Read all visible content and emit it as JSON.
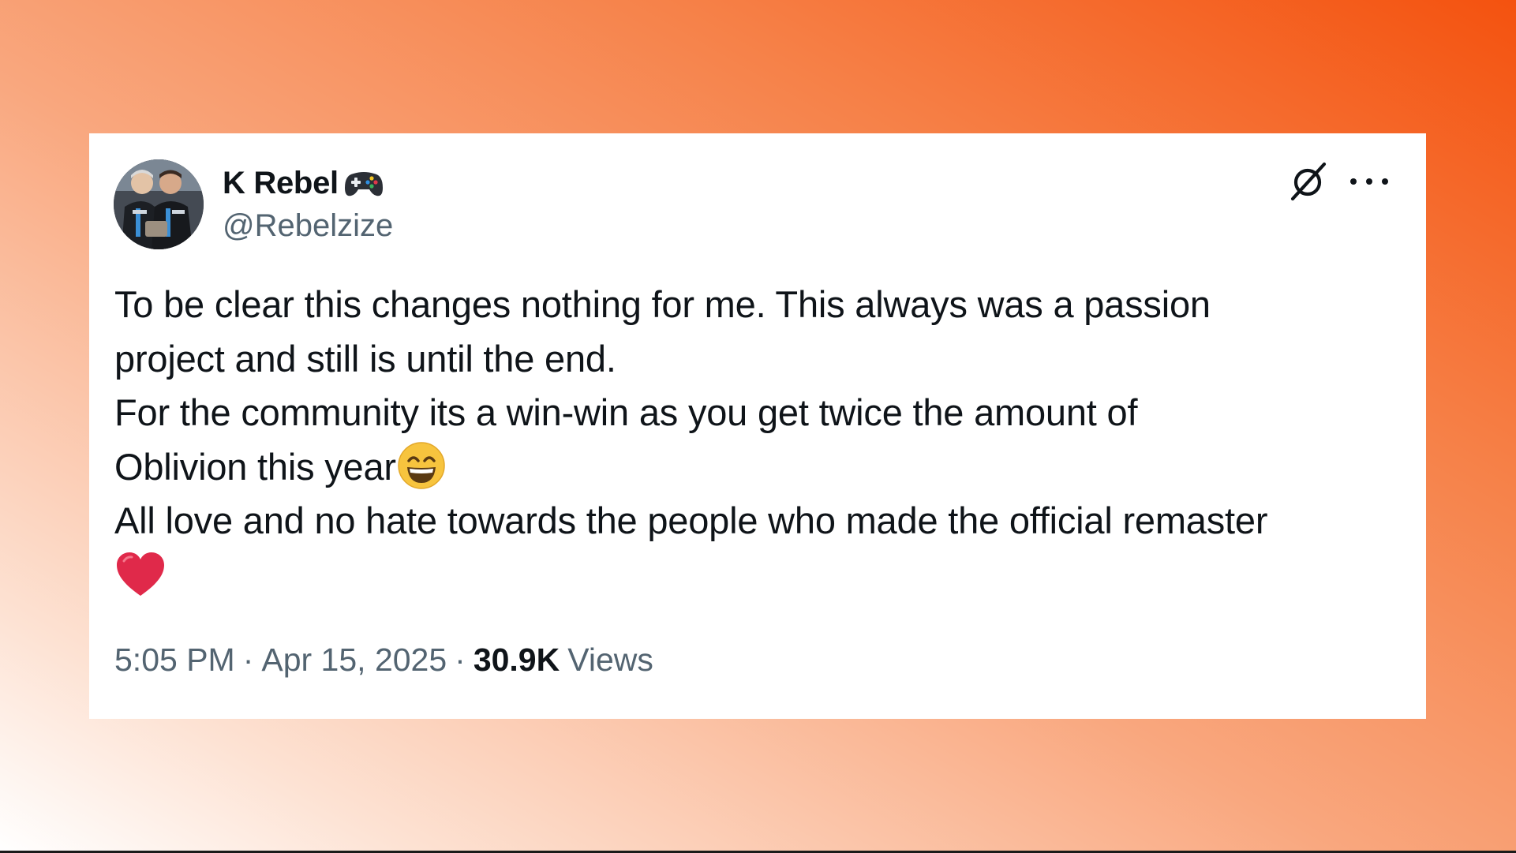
{
  "post": {
    "author": {
      "display_name": "K Rebel",
      "name_emoji": "gamepad-icon",
      "handle": "@Rebelzize"
    },
    "text_lines": [
      "To be clear this changes nothing for me. This always was a passion",
      "project and still is until the end.",
      "For the community its a win-win as you get twice the amount of",
      "Oblivion this year",
      "All love and no hate towards the people who made the official remaster"
    ],
    "inline_emojis": [
      "grinning-squinting-face-icon",
      "red-heart-icon"
    ],
    "time": "5:05 PM",
    "separator": "·",
    "date": "Apr 15, 2025",
    "views_count": "30.9K",
    "views_label": "Views"
  },
  "colors": {
    "text_primary": "#0f1419",
    "text_secondary": "#536471",
    "card_background": "#ffffff",
    "background_gradient_start": "#ffffff",
    "background_gradient_end": "#f4520f",
    "heart": "#e0294a",
    "emoji_face": "#f7c43e"
  }
}
